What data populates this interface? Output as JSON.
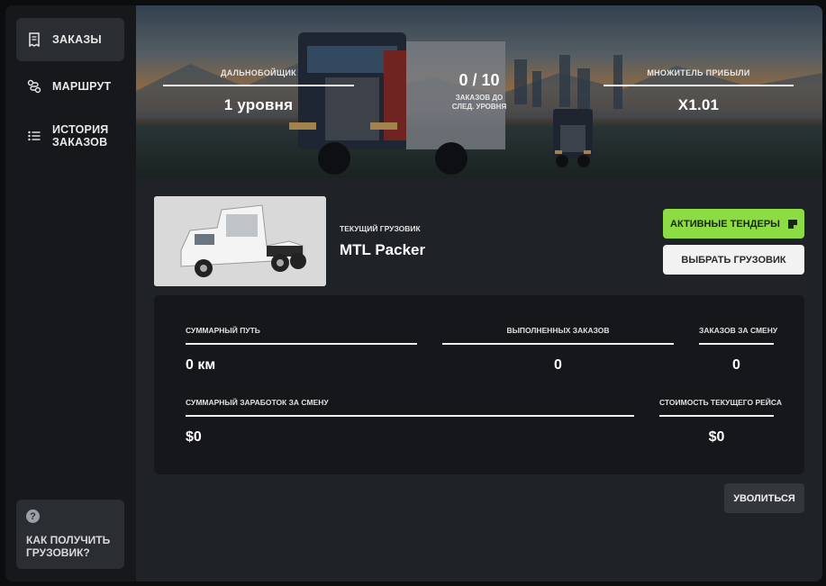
{
  "sidebar": {
    "items": [
      {
        "label": "Заказы",
        "icon": "receipt-icon",
        "active": true
      },
      {
        "label": "Маршрут",
        "icon": "route-icon",
        "active": false
      },
      {
        "label": "История заказов",
        "icon": "list-icon",
        "active": false
      }
    ],
    "help": {
      "label": "Как получить грузовик?",
      "icon": "question-icon",
      "glyph": "?"
    }
  },
  "banner": {
    "rank": {
      "caption": "Дальнобойщик",
      "value": "1 уровня"
    },
    "orders_progress": {
      "value": "0 / 10",
      "caption": "Заказов до след. уровня"
    },
    "multiplier": {
      "caption": "Множитель прибыли",
      "value": "X1.01"
    }
  },
  "truck": {
    "caption": "Текущий грузовик",
    "name": "MTL Packer"
  },
  "buttons": {
    "active_tenders": "Активные тендеры",
    "choose_truck": "Выбрать грузовик",
    "quit": "Уволиться"
  },
  "stats": {
    "total_distance": {
      "caption": "Суммарный путь",
      "value": "0 км"
    },
    "completed_orders": {
      "caption": "Выполненных заказов",
      "value": "0"
    },
    "orders_per_shift": {
      "caption": "Заказов за смену",
      "value": "0"
    },
    "shift_earnings": {
      "caption": "Суммарный заработок за смену",
      "value": "$0"
    },
    "current_trip_cost": {
      "caption": "Стоимость текущего рейса",
      "value": "$0"
    }
  },
  "colors": {
    "accent_green": "#8ddc44",
    "panel_dark": "#15171a",
    "window_bg": "#1f2226",
    "sidebar_bg": "#16181b"
  }
}
